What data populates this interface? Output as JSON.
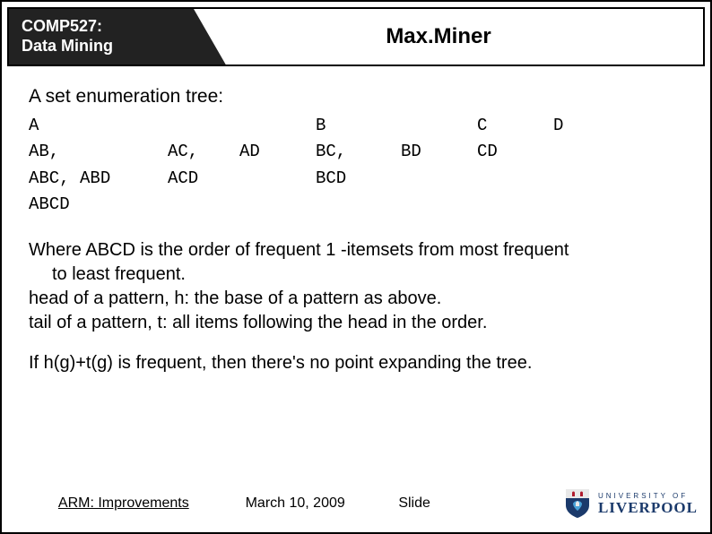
{
  "header": {
    "course_code": "COMP527:",
    "course_name": "Data Mining",
    "title": "Max.Miner"
  },
  "content": {
    "subhead": "A set enumeration tree:",
    "tree": {
      "r1": [
        "A",
        "",
        "",
        "B",
        "",
        "C",
        "D"
      ],
      "r2": [
        "AB,",
        "AC,",
        "AD",
        "BC,",
        "BD",
        "CD",
        ""
      ],
      "r3": [
        "ABC, ABD",
        "ACD",
        "",
        "BCD",
        "",
        "",
        ""
      ],
      "r4": [
        "ABCD",
        "",
        "",
        "",
        "",
        "",
        ""
      ]
    },
    "para1_line1": "Where ABCD is the order of frequent 1 -itemsets from most frequent",
    "para1_line2": "to least frequent.",
    "para1_line3": "head of a pattern, h:  the base of a pattern as above.",
    "para1_line4": "tail of a pattern, t: all items following the head in the order.",
    "para2": "If h(g)+t(g) is frequent, then there's no point expanding the tree."
  },
  "footer": {
    "left": "ARM: Improvements",
    "date": "March 10, 2009",
    "slide_label": "Slide",
    "uni_top": "UNIVERSITY OF",
    "uni_bottom": "LIVERPOOL"
  }
}
